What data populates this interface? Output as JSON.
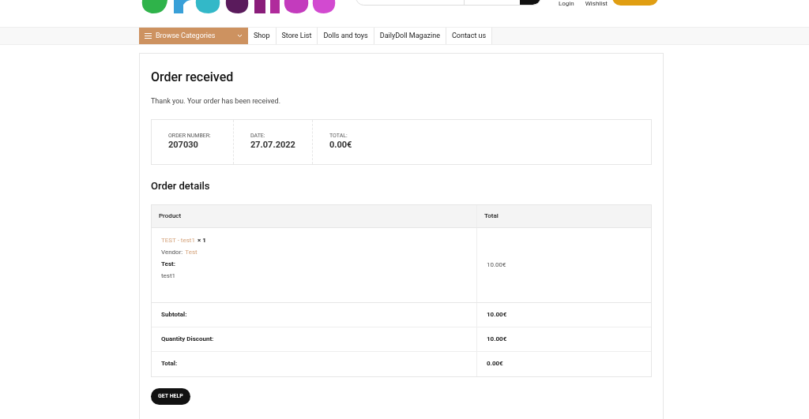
{
  "header": {
    "account_links": [
      "Login",
      "Wishlist"
    ]
  },
  "nav": {
    "categories_button": "Browse Categories",
    "items": [
      "Shop",
      "Store List",
      "Dolls and toys",
      "DailyDoll Magazine",
      "Contact us"
    ]
  },
  "page": {
    "title": "Order received",
    "notice": "Thank you. Your order has been received.",
    "overview": [
      {
        "label": "ORDER NUMBER:",
        "value": "207030"
      },
      {
        "label": "DATE:",
        "value": "27.07.2022"
      },
      {
        "label": "TOTAL:",
        "value": "0.00€"
      }
    ],
    "details_title": "Order details",
    "table": {
      "columns": [
        "Product",
        "Total"
      ],
      "item": {
        "name": "TEST - test1",
        "quantity": "× 1",
        "vendor_label": "Vendor:",
        "vendor": "Test",
        "meta_label": "Test:",
        "meta_value": "test1",
        "total": "10.00€"
      },
      "totals": [
        {
          "label": "Subtotal:",
          "value": "10.00€"
        },
        {
          "label": "Quantity Discount:",
          "value": "10.00€"
        },
        {
          "label": "Total:",
          "value": "0.00€"
        }
      ]
    },
    "help_button": "GET HELP"
  }
}
